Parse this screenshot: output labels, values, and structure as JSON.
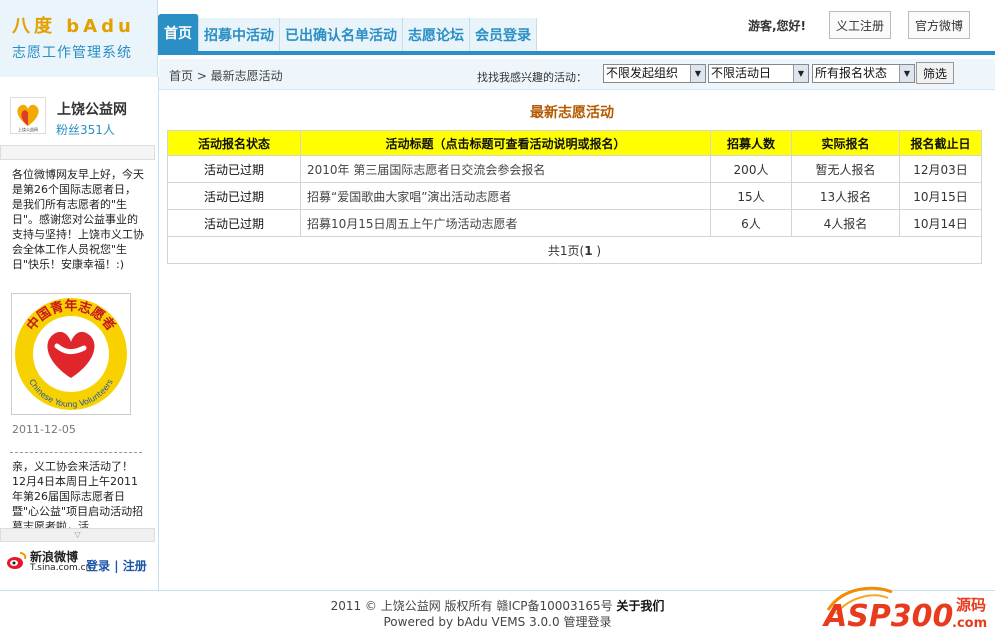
{
  "brand": {
    "line1": "八度 bAdu",
    "line2": "志愿工作管理系统"
  },
  "nav": {
    "items": [
      "首页",
      "招募中活动",
      "已出确认名单活动",
      "志愿论坛",
      "会员登录"
    ]
  },
  "header": {
    "greeting": "游客,您好!",
    "register_label": "义工注册",
    "weibo_label": "官方微博"
  },
  "subbar": {
    "breadcrumb": "首页 > 最新志愿活动",
    "filter_label": "找找我感兴趣的活动：",
    "org_select": "不限发起组织",
    "date_select": "不限活动日",
    "status_select": "所有报名状态",
    "filter_button": "筛选"
  },
  "sidebar": {
    "name": "上饶公益网",
    "fans": "粉丝351人",
    "post1": "各位微博网友早上好，今天是第26个国际志愿者日，是我们所有志愿者的\"生日\"。感谢您对公益事业的支持与坚持！上饶市义工协会全体工作人员祝您\"生日\"快乐！安康幸福！:)",
    "badge_top_text": "中国青年志愿者",
    "badge_bottom_text": "Chinese Young Volunteers",
    "date": "2011-12-05",
    "post2": "亲，义工协会来活动了！12月4日本周日上午2011年第26届国际志愿者日暨\"心公益\"项目启动活动招募志愿者啦，活",
    "weibo_brand": "新浪微博",
    "weibo_domain": "T.sina.com.cn",
    "weibo_login": "登录",
    "weibo_register": "注册"
  },
  "main": {
    "title": "最新志愿活动",
    "columns": [
      "活动报名状态",
      "活动标题（点击标题可查看活动说明或报名）",
      "招募人数",
      "实际报名",
      "报名截止日"
    ],
    "rows": [
      {
        "status": "活动已过期",
        "title": "2010年 第三届国际志愿者日交流会参会报名",
        "recruit": "200人",
        "signed": "暂无人报名",
        "deadline": "12月03日"
      },
      {
        "status": "活动已过期",
        "title": "招募“爱国歌曲大家唱”演出活动志愿者",
        "recruit": "15人",
        "signed": "13人报名",
        "deadline": "10月15日"
      },
      {
        "status": "活动已过期",
        "title": "招募10月15日周五上午广场活动志愿者",
        "recruit": "6人",
        "signed": "4人报名",
        "deadline": "10月14日"
      }
    ],
    "pager_prefix": "共1页(",
    "pager_current": "1",
    "pager_suffix": " )"
  },
  "footer": {
    "copyright": "2011 © 上饶公益网 版权所有 赣ICP备10003165号",
    "about": "关于我们",
    "powered": "Powered by bAdu VEMS 3.0.0",
    "admin_login": "管理登录"
  },
  "watermark": {
    "text": "ASP300",
    "suffix": "源码",
    "domain": ".com"
  },
  "colors": {
    "accent": "#2a8fc4",
    "table_header": "#ffff00",
    "title": "#b35a00"
  }
}
